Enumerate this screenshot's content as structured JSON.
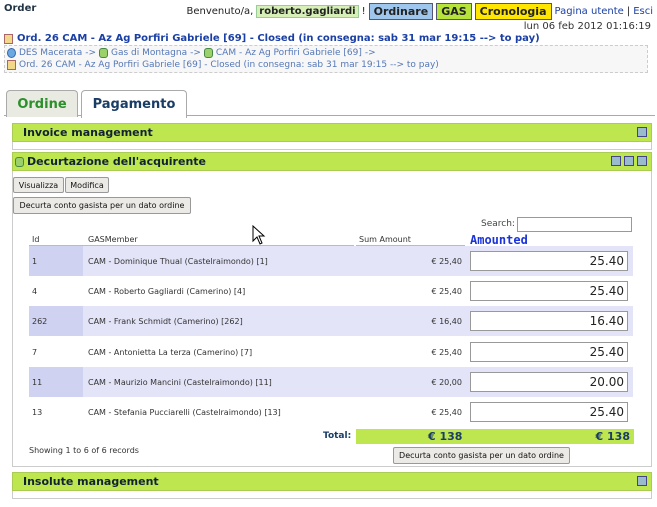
{
  "header": {
    "title": "Order",
    "welcome": "Benvenuto/a,",
    "username": "roberto.gagliardi",
    "buttons": [
      "Ordinare",
      "GAS",
      "Cronologia"
    ],
    "links": [
      "Pagina utente",
      "Esci"
    ],
    "separator": "|",
    "datetime": "lun 06 feb 2012 01:16:19"
  },
  "order_line": "Ord. 26 CAM - Az Ag Porfiri Gabriele [69] - Closed (in consegna: sab 31 mar 19:15 --> to pay)",
  "breadcrumb": {
    "row1": [
      "DES Macerata",
      "->",
      "Gas di Montagna",
      "->",
      "CAM - Az Ag Porfiri Gabriele [69]",
      "->"
    ],
    "row2": "Ord. 26 CAM - Az Ag Porfiri Gabriele [69] - Closed (in consegna: sab 31 mar 19:15 --> to pay)"
  },
  "tabs": [
    "Ordine",
    "Pagamento"
  ],
  "panels": {
    "invoice": "Invoice management",
    "decurtazione": "Decurtazione dell'acquirente",
    "insolute": "Insolute management"
  },
  "toolbar": {
    "visualizza": "Visualizza",
    "modifica": "Modifica",
    "decurta": "Decurta conto gasista per un dato ordine"
  },
  "search": {
    "label": "Search:",
    "value": ""
  },
  "table": {
    "columns": [
      "Id",
      "GASMember",
      "Sum Amount",
      "Amounted"
    ],
    "rows": [
      {
        "id": "1",
        "member": "CAM - Dominique Thual (Castelraimondo) [1]",
        "sum": "€ 25,40",
        "amounted": "25.40"
      },
      {
        "id": "4",
        "member": "CAM - Roberto Gagliardi (Camerino) [4]",
        "sum": "€ 25,40",
        "amounted": "25.40"
      },
      {
        "id": "262",
        "member": "CAM - Frank Schmidt (Camerino) [262]",
        "sum": "€ 16,40",
        "amounted": "16.40"
      },
      {
        "id": "7",
        "member": "CAM - Antonietta La terza (Camerino) [7]",
        "sum": "€ 25,40",
        "amounted": "25.40"
      },
      {
        "id": "11",
        "member": "CAM - Maurizio Mancini (Castelraimondo) [11]",
        "sum": "€ 20,00",
        "amounted": "20.00"
      },
      {
        "id": "13",
        "member": "CAM - Stefania Pucciarelli (Castelraimondo) [13]",
        "sum": "€ 25,40",
        "amounted": "25.40"
      }
    ],
    "total_label": "Total:",
    "total_sum": "€  138",
    "total_amounted": "€  138",
    "showing": "Showing 1 to 6 of 6 records"
  },
  "colors": {
    "panel_green": "#bde64f",
    "row_lavender": "#e3e4f8",
    "link_blue": "#1a3fa5"
  }
}
